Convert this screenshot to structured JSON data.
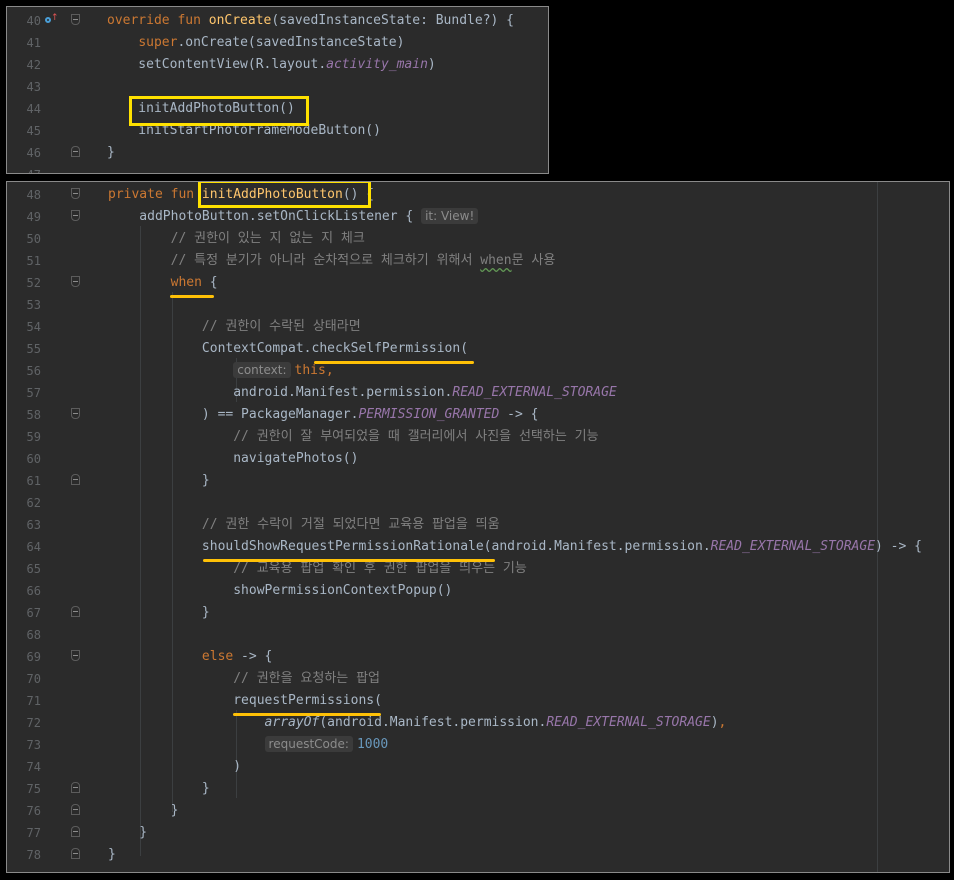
{
  "top_panel": {
    "lines": [
      {
        "num": "40",
        "code": "<span class=\"kw\">override fun </span><span class=\"fn\">onCreate</span>(savedInstanceState: Bundle?) {"
      },
      {
        "num": "41",
        "code": "    <span class=\"kw\">super</span>.onCreate(savedInstanceState)"
      },
      {
        "num": "42",
        "code": "    setContentView(R.layout.<span class=\"it\">activity_main</span>)"
      },
      {
        "num": "43",
        "code": ""
      },
      {
        "num": "44",
        "code": "    initAddPhotoButton()"
      },
      {
        "num": "45",
        "code": "    initStartPhotoFrameModeButton()"
      },
      {
        "num": "46",
        "code": "}"
      },
      {
        "num": "47",
        "code": ""
      }
    ]
  },
  "bottom_panel": {
    "lines": [
      {
        "num": "48",
        "code": "<span class=\"kw\">private fun </span><span class=\"fn\">initAddPhotoButton</span>() {"
      },
      {
        "num": "49",
        "code": "    addPhotoButton.setOnClickListener { <span class=\"hint\">it: View!</span>"
      },
      {
        "num": "50",
        "code": "        <span class=\"cm\">// 권한이 있는 지 없는 지 체크</span>"
      },
      {
        "num": "51",
        "code": "        <span class=\"cm\">// 특정 분기가 아니라 순차적으로 체크하기 위해서 <span class=\"wavy\">when</span>문 사용</span>"
      },
      {
        "num": "52",
        "code": "        <span class=\"kw\">when</span> {"
      },
      {
        "num": "53",
        "code": ""
      },
      {
        "num": "54",
        "code": "            <span class=\"cm\">// 권한이 수락된 상태라면</span>"
      },
      {
        "num": "55",
        "code": "            ContextCompat.checkSelfPermission("
      },
      {
        "num": "56",
        "code": "                <span class=\"hint\">context:</span><span class=\"kw\">this,</span>"
      },
      {
        "num": "57",
        "code": "                android.Manifest.permission.<span class=\"it\">READ_EXTERNAL_STORAGE</span>"
      },
      {
        "num": "58",
        "code": "            ) == PackageManager.<span class=\"it\">PERMISSION_GRANTED</span> -&gt; {"
      },
      {
        "num": "59",
        "code": "                <span class=\"cm\">// 권한이 잘 부여되었을 때 갤러리에서 사진을 선택하는 기능</span>"
      },
      {
        "num": "60",
        "code": "                navigatePhotos()"
      },
      {
        "num": "61",
        "code": "            }"
      },
      {
        "num": "62",
        "code": ""
      },
      {
        "num": "63",
        "code": "            <span class=\"cm\">// 권한 수락이 거절 되었다면 교육용 팝업을 띄움</span>"
      },
      {
        "num": "64",
        "code": "            shouldShowRequestPermissionRationale(android.Manifest.permission.<span class=\"it\">READ_EXTERNAL_STORAGE</span>) -&gt; {"
      },
      {
        "num": "65",
        "code": "                <span class=\"cm\">// 교육용 팝업 확인 후 권한 팝업을 띄우는 기능</span>"
      },
      {
        "num": "66",
        "code": "                showPermissionContextPopup()"
      },
      {
        "num": "67",
        "code": "            }"
      },
      {
        "num": "68",
        "code": ""
      },
      {
        "num": "69",
        "code": "            <span class=\"kw\">else</span> -&gt; {"
      },
      {
        "num": "70",
        "code": "                <span class=\"cm\">// 권한을 요청하는 팝업</span>"
      },
      {
        "num": "71",
        "code": "                requestPermissions("
      },
      {
        "num": "72",
        "code": "                    <span class=\"it\" style=\"color:#a9b7c6\">arrayOf</span>(android.Manifest.permission.<span class=\"it\">READ_EXTERNAL_STORAGE</span>)<span class=\"kw\">,</span>"
      },
      {
        "num": "73",
        "code": "                    <span class=\"hint\">requestCode:</span><span class=\"num\">1000</span>"
      },
      {
        "num": "74",
        "code": "                )"
      },
      {
        "num": "75",
        "code": "            }"
      },
      {
        "num": "76",
        "code": "        }"
      },
      {
        "num": "77",
        "code": "    }"
      },
      {
        "num": "78",
        "code": "}"
      }
    ]
  },
  "icons": {
    "override_gutter": "override-method-icon",
    "fold_marker": "fold-marker-icon"
  },
  "colors": {
    "background": "#2b2b2b",
    "keyword": "#cc7832",
    "function": "#ffc66d",
    "comment": "#808080",
    "constant": "#9876aa",
    "highlight_box": "#ffe100",
    "underline": "#ffc107"
  }
}
